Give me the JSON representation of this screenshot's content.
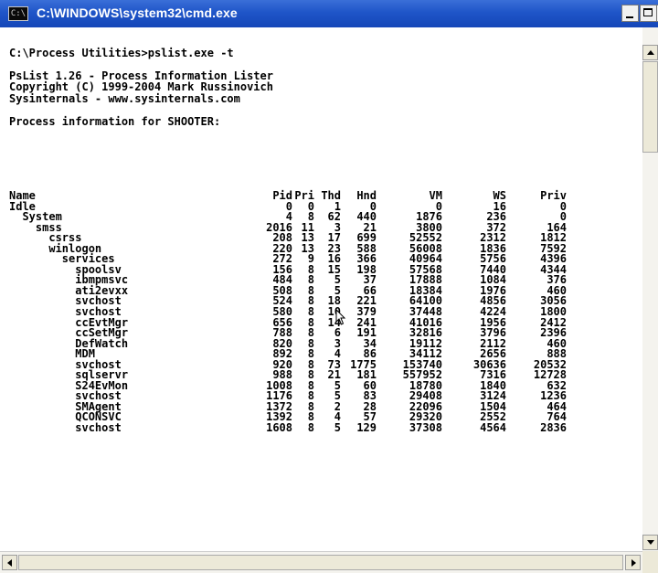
{
  "window": {
    "title": "C:\\WINDOWS\\system32\\cmd.exe",
    "icon_label": "C:\\",
    "titlebar_color": "#1f55c8"
  },
  "console": {
    "header_lines": [
      "",
      "C:\\Process Utilities>pslist.exe -t",
      "",
      "PsList 1.26 - Process Information Lister",
      "Copyright (C) 1999-2004 Mark Russinovich",
      "Sysinternals - www.sysinternals.com",
      "",
      "Process information for SHOOTER:"
    ],
    "columns": [
      "Name",
      "Pid",
      "Pri",
      "Thd",
      "Hnd",
      "VM",
      "WS",
      "Priv"
    ],
    "rows": [
      {
        "name": "Idle",
        "pid": "0",
        "pri": "0",
        "thd": "1",
        "hnd": "0",
        "vm": "0",
        "ws": "16",
        "priv": "0"
      },
      {
        "name": "  System",
        "pid": "4",
        "pri": "8",
        "thd": "62",
        "hnd": "440",
        "vm": "1876",
        "ws": "236",
        "priv": "0"
      },
      {
        "name": "    smss",
        "pid": "2016",
        "pri": "11",
        "thd": "3",
        "hnd": "21",
        "vm": "3800",
        "ws": "372",
        "priv": "164"
      },
      {
        "name": "      csrss",
        "pid": "208",
        "pri": "13",
        "thd": "17",
        "hnd": "699",
        "vm": "52552",
        "ws": "2312",
        "priv": "1812"
      },
      {
        "name": "      winlogon",
        "pid": "220",
        "pri": "13",
        "thd": "23",
        "hnd": "588",
        "vm": "56008",
        "ws": "1836",
        "priv": "7592"
      },
      {
        "name": "        services",
        "pid": "272",
        "pri": "9",
        "thd": "16",
        "hnd": "366",
        "vm": "40964",
        "ws": "5756",
        "priv": "4396"
      },
      {
        "name": "          spoolsv",
        "pid": "156",
        "pri": "8",
        "thd": "15",
        "hnd": "198",
        "vm": "57568",
        "ws": "7440",
        "priv": "4344"
      },
      {
        "name": "          ibmpmsvc",
        "pid": "484",
        "pri": "8",
        "thd": "5",
        "hnd": "37",
        "vm": "17888",
        "ws": "1084",
        "priv": "376"
      },
      {
        "name": "          ati2evxx",
        "pid": "508",
        "pri": "8",
        "thd": "5",
        "hnd": "66",
        "vm": "18384",
        "ws": "1976",
        "priv": "460"
      },
      {
        "name": "          svchost",
        "pid": "524",
        "pri": "8",
        "thd": "18",
        "hnd": "221",
        "vm": "64100",
        "ws": "4856",
        "priv": "3056"
      },
      {
        "name": "          svchost",
        "pid": "580",
        "pri": "8",
        "thd": "10",
        "hnd": "379",
        "vm": "37448",
        "ws": "4224",
        "priv": "1800"
      },
      {
        "name": "          ccEvtMgr",
        "pid": "656",
        "pri": "8",
        "thd": "14",
        "hnd": "241",
        "vm": "41016",
        "ws": "1956",
        "priv": "2412"
      },
      {
        "name": "          ccSetMgr",
        "pid": "788",
        "pri": "8",
        "thd": "6",
        "hnd": "191",
        "vm": "32816",
        "ws": "3796",
        "priv": "2396"
      },
      {
        "name": "          DefWatch",
        "pid": "820",
        "pri": "8",
        "thd": "3",
        "hnd": "34",
        "vm": "19112",
        "ws": "2112",
        "priv": "460"
      },
      {
        "name": "          MDM",
        "pid": "892",
        "pri": "8",
        "thd": "4",
        "hnd": "86",
        "vm": "34112",
        "ws": "2656",
        "priv": "888"
      },
      {
        "name": "          svchost",
        "pid": "920",
        "pri": "8",
        "thd": "73",
        "hnd": "1775",
        "vm": "153740",
        "ws": "30636",
        "priv": "20532"
      },
      {
        "name": "          sqlservr",
        "pid": "988",
        "pri": "8",
        "thd": "21",
        "hnd": "181",
        "vm": "557952",
        "ws": "7316",
        "priv": "12728"
      },
      {
        "name": "          S24EvMon",
        "pid": "1008",
        "pri": "8",
        "thd": "5",
        "hnd": "60",
        "vm": "18780",
        "ws": "1840",
        "priv": "632"
      },
      {
        "name": "          svchost",
        "pid": "1176",
        "pri": "8",
        "thd": "5",
        "hnd": "83",
        "vm": "29408",
        "ws": "3124",
        "priv": "1236"
      },
      {
        "name": "          SMAgent",
        "pid": "1372",
        "pri": "8",
        "thd": "2",
        "hnd": "28",
        "vm": "22096",
        "ws": "1504",
        "priv": "464"
      },
      {
        "name": "          QCONSVC",
        "pid": "1392",
        "pri": "8",
        "thd": "4",
        "hnd": "57",
        "vm": "29320",
        "ws": "2552",
        "priv": "764"
      },
      {
        "name": "          svchost",
        "pid": "1608",
        "pri": "8",
        "thd": "5",
        "hnd": "129",
        "vm": "37308",
        "ws": "4564",
        "priv": "2836"
      }
    ]
  }
}
